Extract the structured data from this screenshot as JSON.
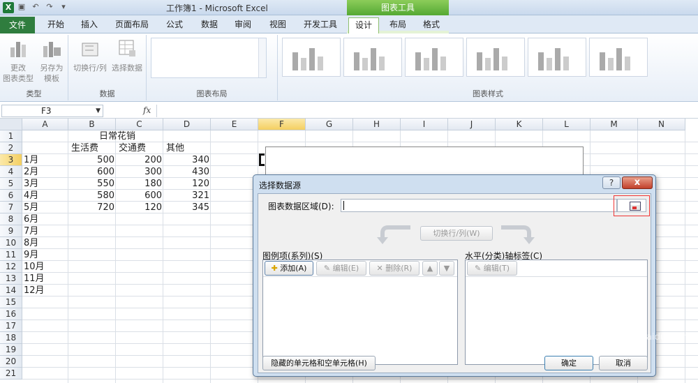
{
  "titlebar": {
    "title": "工作簿1 - Microsoft Excel",
    "context_group": "图表工具",
    "app_icon": "excel-icon",
    "quick_access": [
      "save-icon",
      "undo-icon",
      "redo-icon",
      "customize-icon"
    ]
  },
  "tabs": [
    {
      "label": "文件",
      "kind": "file"
    },
    {
      "label": "开始"
    },
    {
      "label": "插入"
    },
    {
      "label": "页面布局"
    },
    {
      "label": "公式"
    },
    {
      "label": "数据"
    },
    {
      "label": "审阅"
    },
    {
      "label": "视图"
    },
    {
      "label": "开发工具"
    },
    {
      "label": "设计",
      "active": true
    },
    {
      "label": "布局"
    },
    {
      "label": "格式"
    }
  ],
  "ribbon": {
    "groups": {
      "type": "类型",
      "data": "数据",
      "layout": "图表布局",
      "styles": "图表样式"
    },
    "buttons": {
      "change_type_1": "更改",
      "change_type_2": "图表类型",
      "save_template_1": "另存为",
      "save_template_2": "模板",
      "switch_row_col": "切换行/列",
      "select_data": "选择数据"
    }
  },
  "formula_bar": {
    "name_box": "F3",
    "fx": "fx",
    "value": ""
  },
  "sheet": {
    "columns": [
      "A",
      "B",
      "C",
      "D",
      "E",
      "F",
      "G",
      "H",
      "I",
      "J",
      "K",
      "L",
      "M",
      "N"
    ],
    "selected_column": "F",
    "selected_row": 3,
    "rows": [
      1,
      2,
      3,
      4,
      5,
      6,
      7,
      8,
      9,
      10,
      11,
      12,
      13,
      14,
      15,
      16,
      17,
      18,
      19,
      20,
      21
    ],
    "title": "日常花销",
    "headers": [
      "生活费",
      "交通费",
      "其他"
    ],
    "months": [
      "1月",
      "2月",
      "3月",
      "4月",
      "5月",
      "6月",
      "7月",
      "8月",
      "9月",
      "10月",
      "11月",
      "12月"
    ],
    "values": [
      [
        500,
        200,
        340
      ],
      [
        600,
        300,
        430
      ],
      [
        550,
        180,
        120
      ],
      [
        580,
        600,
        321
      ],
      [
        720,
        120,
        345
      ]
    ]
  },
  "dialog": {
    "title": "选择数据源",
    "help": "?",
    "close": "x",
    "range_label": "图表数据区域(D):",
    "range_value": "",
    "switch_button": "切换行/列(W)",
    "series_label": "图例项(系列)(S)",
    "axis_label": "水平(分类)轴标签(C)",
    "add_button": "添加(A)",
    "edit_button": "编辑(E)",
    "delete_button": "删除(R)",
    "axis_edit_button": "编辑(T)",
    "hidden_cells_button": "隐藏的单元格和空单元格(H)",
    "ok_button": "确定",
    "cancel_button": "取消"
  },
  "watermark": {
    "text": "Bai经验",
    "sub": "jingyan.baidu.com"
  }
}
